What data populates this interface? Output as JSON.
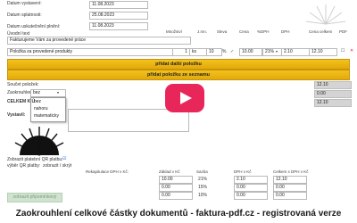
{
  "form": {
    "date_issue_label": "Datum vystavení:",
    "date_issue_value": "11.08.2023",
    "date_due_label": "Datum splatnosti:",
    "date_due_value": "25.08.2023",
    "date_tax_label": "Datum uskutečnění plnění:",
    "date_tax_value": "11.08.2023",
    "intro_text_label": "Úvodní text",
    "intro_text_value": "Fakturujeme Vám za provedené práce"
  },
  "items_table": {
    "headers": [
      "Množství",
      "J.mn.",
      "Sleva",
      "Cena",
      "%DPH",
      "DPH",
      "Cena celkem",
      "PDF"
    ],
    "row": {
      "name": "Položka za provedené produkty",
      "quantity": "1",
      "unit": "ks",
      "discount": "10",
      "discount_unit": "%",
      "price": "10.00",
      "vat_rate": "21%",
      "vat": "2.10",
      "total": "12.10"
    }
  },
  "buttons": {
    "add_item": "přidat další položku",
    "add_from_list": "přidat položku ze seznamu",
    "show_pdf": "zobrazit připomínkový"
  },
  "rounding": {
    "last_item_label": "Součet položek:",
    "rounding_label": "Zaokrouhlení:",
    "rounding_selected": "bez",
    "options": [
      "bez",
      "nahoru",
      "matematicky"
    ],
    "total_label": "CELKEM K Ú",
    "sum_value": "12.10",
    "round_value": "0.00",
    "total_value": "12.10"
  },
  "footer_form": {
    "issued_by_label": "Vystavil:",
    "show_qr_label": "Zobrazit platební QR platbu:",
    "qr_options_label": "výběr QR platby:",
    "qr_option_value": "zobrazit / skrýt"
  },
  "vat_summary": {
    "headers": [
      "Rekapitulace DPH v Kč:",
      "Základ v Kč",
      "Sazba",
      "DPH v Kč",
      "Celkem s DPH v Kč"
    ],
    "rows": [
      [
        "",
        "10.00",
        "21%",
        "2.10",
        "12.10"
      ],
      [
        "",
        "0.00",
        "15%",
        "0.00",
        "0.00"
      ],
      [
        "",
        "0.00",
        "10%",
        "0.00",
        "0.00"
      ]
    ]
  },
  "caption": "Zaokrouhlení celkové částky dokumentů - faktura-pdf.cz - registrovaná verze",
  "colors": {
    "play_button": "#e8265a",
    "add_button": "#f0b915",
    "field_border": "#b9b9b9"
  }
}
